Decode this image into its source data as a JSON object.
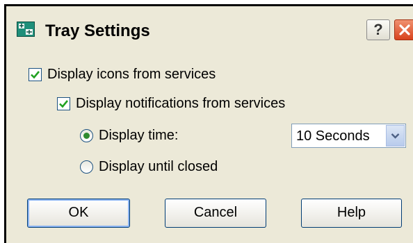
{
  "window": {
    "title": "Tray Settings",
    "help_label": "?"
  },
  "options": {
    "display_icons": {
      "label": "Display icons from services",
      "checked": true
    },
    "display_notifications": {
      "label": "Display notifications from services",
      "checked": true
    },
    "display_time": {
      "label": "Display time:",
      "selected": true
    },
    "display_until_closed": {
      "label": "Display until closed",
      "selected": false
    },
    "display_time_select": {
      "value": "10 Seconds"
    }
  },
  "buttons": {
    "ok": "OK",
    "cancel": "Cancel",
    "help": "Help"
  },
  "icons": {
    "app": "tray-app-icon",
    "help": "question-mark-icon",
    "close": "close-icon",
    "check": "check-icon",
    "dropdown": "chevron-down-icon"
  },
  "colors": {
    "dialog_background": "#ece9d8",
    "close_button": "#d8431d",
    "check_mark": "#21a121",
    "radio_dot": "#2f8a2f",
    "button_border": "#003c74"
  }
}
